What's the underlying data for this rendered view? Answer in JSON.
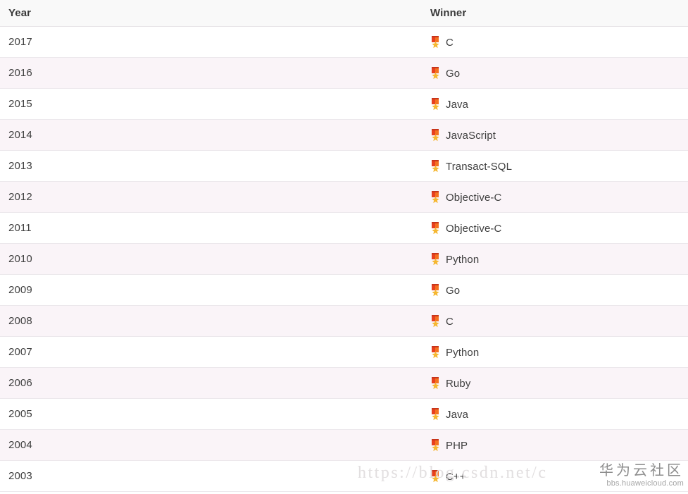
{
  "table": {
    "columns": [
      {
        "key": "year",
        "label": "Year"
      },
      {
        "key": "winner",
        "label": "Winner"
      }
    ],
    "medal_icon": "military-medal-icon",
    "rows": [
      {
        "year": "2017",
        "winner": "C"
      },
      {
        "year": "2016",
        "winner": "Go"
      },
      {
        "year": "2015",
        "winner": "Java"
      },
      {
        "year": "2014",
        "winner": "JavaScript"
      },
      {
        "year": "2013",
        "winner": "Transact-SQL"
      },
      {
        "year": "2012",
        "winner": "Objective-C"
      },
      {
        "year": "2011",
        "winner": "Objective-C"
      },
      {
        "year": "2010",
        "winner": "Python"
      },
      {
        "year": "2009",
        "winner": "Go"
      },
      {
        "year": "2008",
        "winner": "C"
      },
      {
        "year": "2007",
        "winner": "Python"
      },
      {
        "year": "2006",
        "winner": "Ruby"
      },
      {
        "year": "2005",
        "winner": "Java"
      },
      {
        "year": "2004",
        "winner": "PHP"
      },
      {
        "year": "2003",
        "winner": "C++"
      }
    ]
  },
  "watermarks": {
    "csdn": "https://blog.csdn.net/c",
    "huawei_cn": "华为云社区",
    "huawei_url": "bbs.huaweicloud.com"
  },
  "colors": {
    "header_bg": "#f9f9f9",
    "row_odd_bg": "#ffffff",
    "row_even_bg": "#faf4f8",
    "border": "#ece8ec",
    "text": "#3f3f3f",
    "header_text": "#3a3a3a",
    "medal_ribbon": "#e8401f",
    "medal_star": "#f5b731",
    "watermark": "#e2dfe0"
  }
}
